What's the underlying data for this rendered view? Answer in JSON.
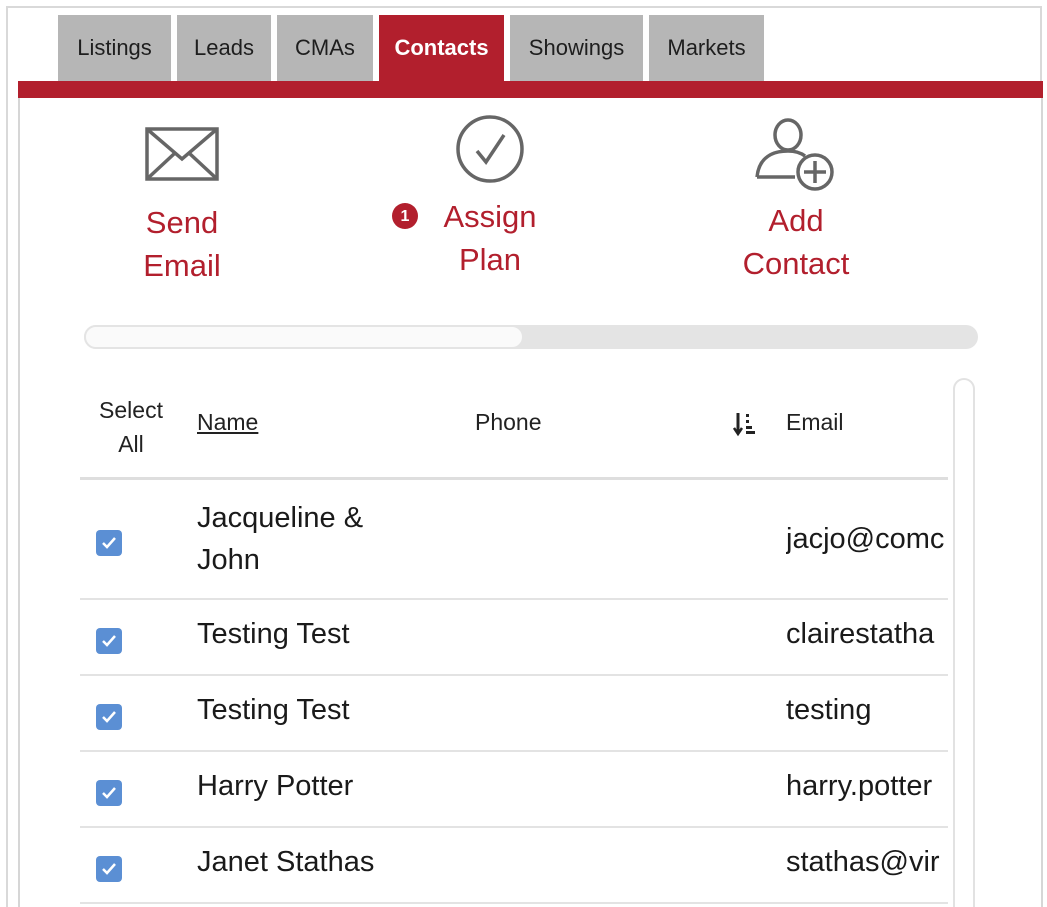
{
  "tabs": [
    {
      "label": "Listings"
    },
    {
      "label": "Leads"
    },
    {
      "label": "CMAs"
    },
    {
      "label": "Contacts"
    },
    {
      "label": "Showings"
    },
    {
      "label": "Markets"
    }
  ],
  "active_tab": "Contacts",
  "actions": {
    "send_email": {
      "line1": "Send",
      "line2": "Email",
      "icon": "envelope-icon"
    },
    "assign_plan": {
      "line1": "Assign",
      "line2": "Plan",
      "icon": "check-circle-icon",
      "badge": "1"
    },
    "add_contact": {
      "line1": "Add",
      "line2": "Contact",
      "icon": "add-person-icon"
    }
  },
  "table": {
    "select_all_line1": "Select",
    "select_all_line2": "All",
    "col_name": "Name",
    "col_phone": "Phone",
    "col_email": "Email",
    "sort_icon": "sort-descending-icon",
    "rows": [
      {
        "name_line1": "Jacqueline &",
        "name_line2": "John",
        "phone": "",
        "email": "jacjo@comc",
        "checked": true
      },
      {
        "name_line1": "Testing Test",
        "name_line2": "",
        "phone": "",
        "email": "clairestatha",
        "checked": true
      },
      {
        "name_line1": "Testing Test",
        "name_line2": "",
        "phone": "",
        "email": "testing",
        "checked": true
      },
      {
        "name_line1": "Harry Potter",
        "name_line2": "",
        "phone": "",
        "email": "harry.potter",
        "checked": true
      },
      {
        "name_line1": "Janet Stathas",
        "name_line2": "",
        "phone": "",
        "email": "stathas@vir",
        "checked": true
      }
    ]
  },
  "colors": {
    "accent": "#b21f2d",
    "checkbox": "#5b8fd4",
    "tab_inactive": "#b6b6b6"
  }
}
